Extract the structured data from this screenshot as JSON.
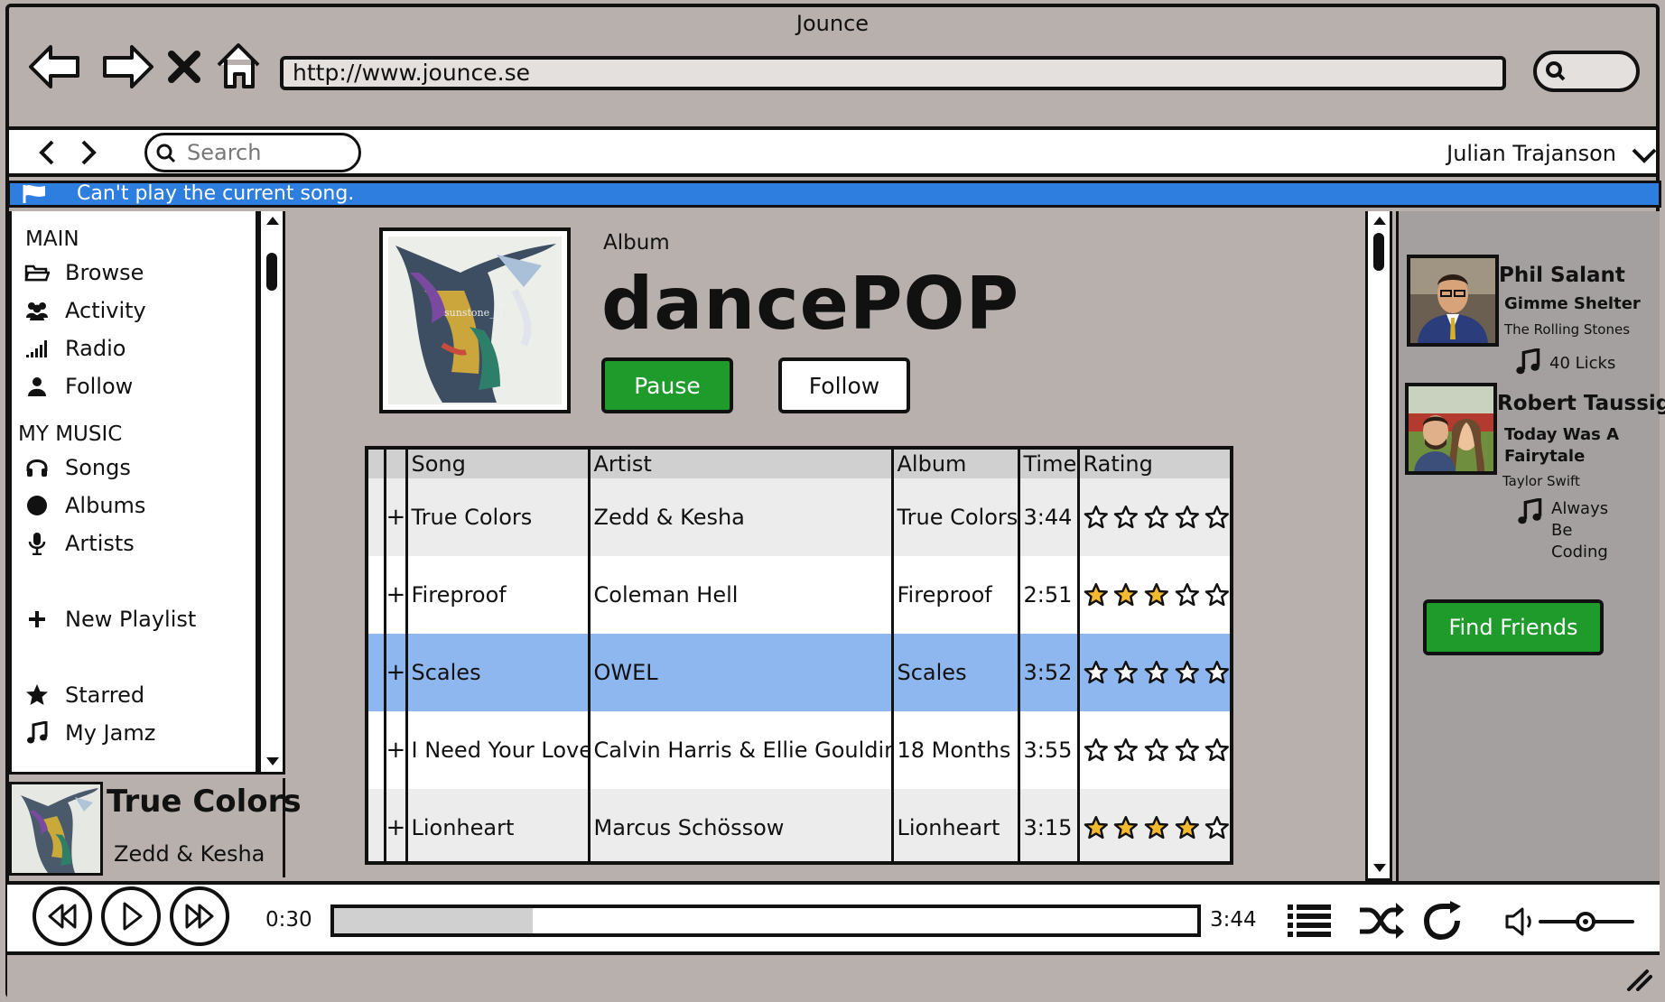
{
  "browser": {
    "title": "Jounce",
    "url": "http://www.jounce.se",
    "icons": [
      "back-arrow-icon",
      "forward-arrow-icon",
      "close-x-icon",
      "home-icon",
      "search-icon"
    ]
  },
  "toolbar": {
    "search_placeholder": "Search",
    "user_name": "Julian Trajanson"
  },
  "alert": {
    "message": "Can't play the current song."
  },
  "sidebar": {
    "main_heading": "MAIN",
    "main_items": [
      {
        "label": "Browse",
        "icon": "folder-icon"
      },
      {
        "label": "Activity",
        "icon": "users-icon"
      },
      {
        "label": "Radio",
        "icon": "signal-icon"
      },
      {
        "label": "Follow",
        "icon": "user-icon"
      }
    ],
    "music_heading": "MY MUSIC",
    "music_items": [
      {
        "label": "Songs",
        "icon": "headphones-icon"
      },
      {
        "label": "Albums",
        "icon": "disc-icon"
      },
      {
        "label": "Artists",
        "icon": "microphone-icon"
      }
    ],
    "new_playlist": "New Playlist",
    "extra_items": [
      {
        "label": "Starred",
        "icon": "star-icon"
      },
      {
        "label": "My Jamz",
        "icon": "music-note-icon"
      }
    ]
  },
  "now_playing": {
    "title": "True Colors",
    "artist": "Zedd & Kesha"
  },
  "album": {
    "label": "Album",
    "title": "dancePOP",
    "pause_label": "Pause",
    "follow_label": "Follow",
    "cover_caption": "sunstone_01"
  },
  "songs": {
    "columns": [
      "Song",
      "Artist",
      "Album",
      "Time",
      "Rating"
    ],
    "rows": [
      {
        "add": "+",
        "song": "True Colors",
        "artist": "Zedd & Kesha",
        "album": "True Colors",
        "time": "3:44",
        "rating": 0
      },
      {
        "add": "+",
        "song": "Fireproof",
        "artist": "Coleman Hell",
        "album": "Fireproof",
        "time": "2:51",
        "rating": 3
      },
      {
        "add": "+",
        "song": "Scales",
        "artist": "OWEL",
        "album": "Scales",
        "time": "3:52",
        "rating": 0,
        "selected": true
      },
      {
        "add": "+",
        "song": "I Need Your Love",
        "artist": "Calvin Harris & Ellie Goulding",
        "album": "18 Months",
        "time": "3:55",
        "rating": 0
      },
      {
        "add": "+",
        "song": "Lionheart",
        "artist": "Marcus Schössow",
        "album": "Lionheart",
        "time": "3:15",
        "rating": 4
      }
    ]
  },
  "friends": {
    "list": [
      {
        "name": "Phil Salant",
        "song": "Gimme Shelter",
        "artist": "The Rolling Stones",
        "track": "40 Licks"
      },
      {
        "name": "Robert Taussig",
        "song": "Today Was A Fairytale",
        "artist": "Taylor Swift",
        "track": "Always Be Coding"
      }
    ],
    "find_label": "Find Friends"
  },
  "player": {
    "elapsed": "0:30",
    "duration": "3:44",
    "progress_fraction": 0.23,
    "volume_fraction": 0.5
  },
  "colors": {
    "accent_green": "#1f9b2c",
    "alert_blue": "#2e7ee0",
    "selected_row": "#8fb7ef",
    "star_fill": "#f3b92f",
    "background": "#b7b0ad"
  }
}
